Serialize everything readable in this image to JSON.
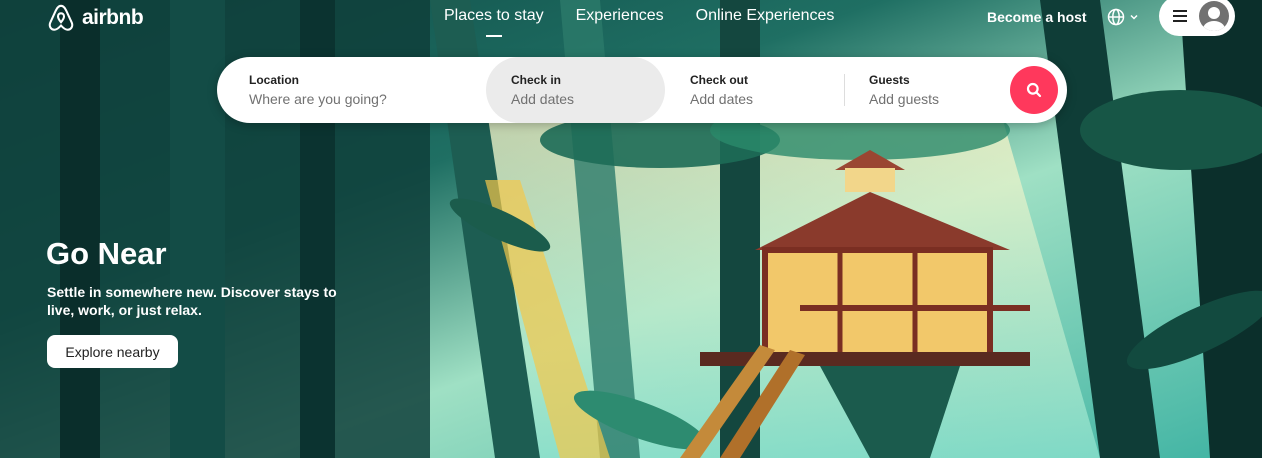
{
  "brand": {
    "name": "airbnb",
    "accent": "#ff385c"
  },
  "nav": {
    "items": [
      {
        "label": "Places to stay",
        "active": true
      },
      {
        "label": "Experiences",
        "active": false
      },
      {
        "label": "Online Experiences",
        "active": false
      }
    ]
  },
  "header": {
    "host_label": "Become a host",
    "language_icon": "globe-icon",
    "menu_icon": "hamburger-icon",
    "avatar_icon": "user-avatar-icon"
  },
  "search": {
    "location": {
      "label": "Location",
      "placeholder": "Where are you going?"
    },
    "checkin": {
      "label": "Check in",
      "placeholder": "Add dates"
    },
    "checkout": {
      "label": "Check out",
      "placeholder": "Add dates"
    },
    "guests": {
      "label": "Guests",
      "placeholder": "Add guests"
    },
    "button_icon": "search-icon"
  },
  "hero": {
    "title": "Go Near",
    "subtitle": "Settle in somewhere new. Discover stays to live, work, or just relax.",
    "cta_label": "Explore nearby"
  }
}
